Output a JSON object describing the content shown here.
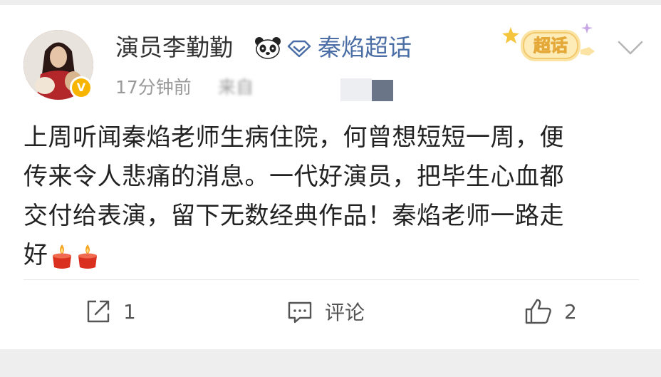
{
  "post": {
    "author_name": "演员李勤勤",
    "topic_name": "秦焰超话",
    "super_topic_badge": "超话",
    "timestamp": "17分钟前",
    "source_prefix": "来自",
    "body_lines": [
      "上周听闻秦焰老师生病住院，何曾想短短一周，便",
      "传来令人悲痛的消息。一代好演员，把毕生心血都",
      "交付给表演，留下无数经典作品！秦焰老师一路走",
      "好"
    ]
  },
  "actions": {
    "repost_count": "1",
    "comment_label": "评论",
    "like_count": "2"
  },
  "colors": {
    "topic_link": "#4a6ea5",
    "meta_text": "#9a9a9a",
    "badge_gold": "#f7b500",
    "divider": "#e6e6e6"
  }
}
